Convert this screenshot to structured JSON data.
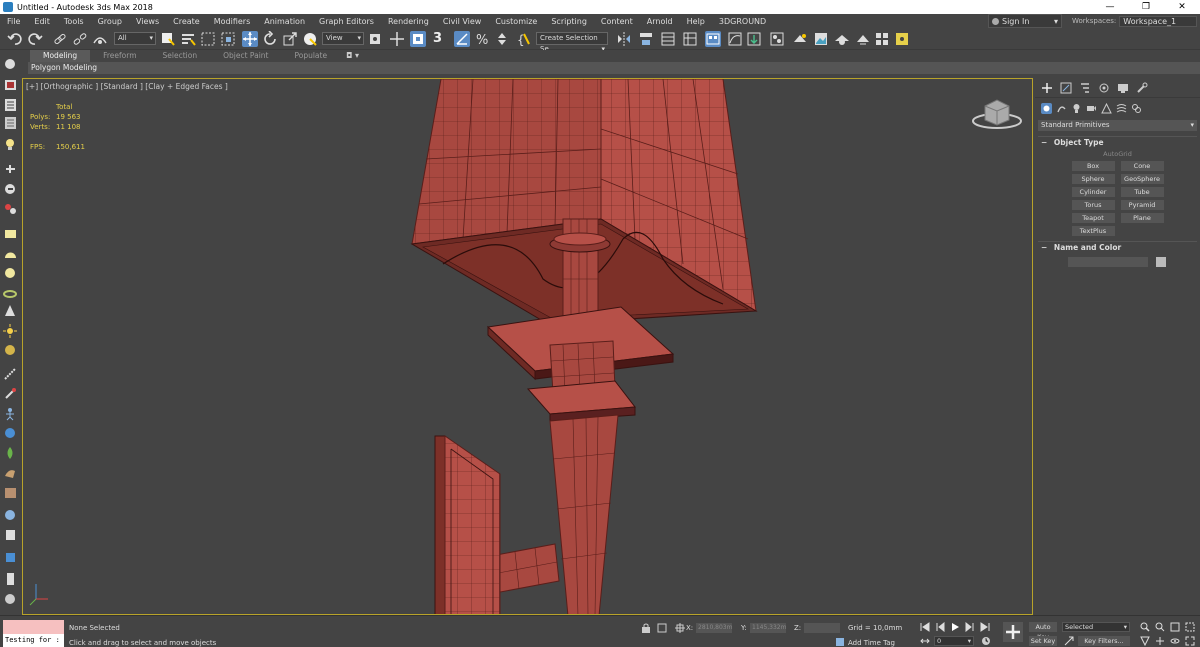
{
  "window": {
    "title": "Untitled - Autodesk 3ds Max 2018",
    "minimize": "—",
    "maximize": "❐",
    "close": "✕"
  },
  "menu": [
    "File",
    "Edit",
    "Tools",
    "Group",
    "Views",
    "Create",
    "Modifiers",
    "Animation",
    "Graph Editors",
    "Rendering",
    "Civil View",
    "Customize",
    "Scripting",
    "Content",
    "Arnold",
    "Help",
    "3DGROUND"
  ],
  "account": {
    "signin": "Sign In",
    "workspaces_label": "Workspaces:",
    "workspace": "Workspace_1"
  },
  "toolbar": {
    "filter": "All",
    "refcoord": "View",
    "selection_set": "Create Selection Se",
    "snap_label": "3"
  },
  "ribbon": {
    "tabs": [
      "Modeling",
      "Freeform",
      "Selection",
      "Object Paint",
      "Populate"
    ],
    "active_tab": "Modeling",
    "subpanel": "Polygon Modeling"
  },
  "viewport": {
    "label": "[+] [Orthographic ] [Standard ] [Clay + Edged Faces ]",
    "stats": {
      "header": "Total",
      "polys_label": "Polys:",
      "polys": "19 563",
      "verts_label": "Verts:",
      "verts": "11 108",
      "fps_label": "FPS:",
      "fps": "150,611"
    }
  },
  "command_panel": {
    "category": "Standard Primitives",
    "object_type_header": "Object Type",
    "autogrid": "AutoGrid",
    "primitives": [
      "Box",
      "Cone",
      "Sphere",
      "GeoSphere",
      "Cylinder",
      "Tube",
      "Torus",
      "Pyramid",
      "Teapot",
      "Plane",
      "TextPlus"
    ],
    "name_color_header": "Name and Color"
  },
  "status": {
    "maxscript_text": "Testing for :",
    "selection": "None Selected",
    "prompt": "Click and drag to select and move objects",
    "x_label": "X:",
    "x_value": "2810,803m",
    "y_label": "Y:",
    "y_value": "1145,332m",
    "z_label": "Z:",
    "z_value": "",
    "grid": "Grid = 10,0mm",
    "add_time_tag": "Add Time Tag",
    "auto_key": "Auto Key",
    "set_key": "Set Key",
    "key_mode": "Selected",
    "key_filters": "Key Filters...",
    "frame": "0"
  },
  "colors": {
    "ui_bg": "#444444",
    "viewport_border": "#b8a32a",
    "mesh": "#b4504a",
    "stats_text": "#e6d04a"
  }
}
